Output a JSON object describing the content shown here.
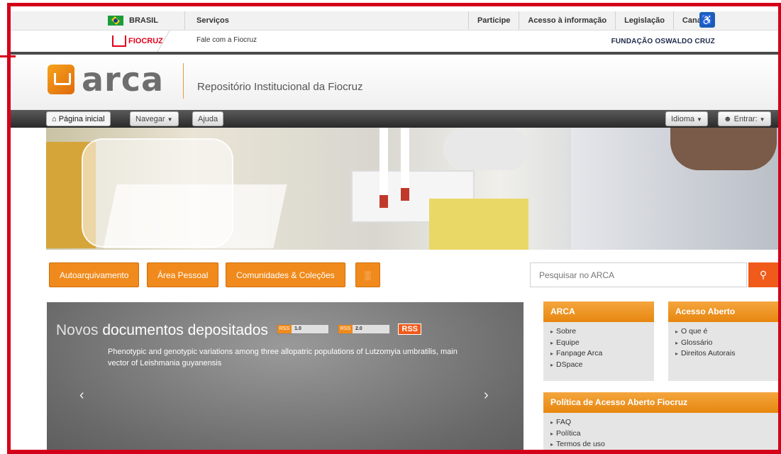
{
  "gov": {
    "country": "BRASIL",
    "services": "Serviços",
    "links": [
      "Participe",
      "Acesso à informação",
      "Legislação",
      "Canais"
    ]
  },
  "fiocruz": {
    "logo": "FIOCRUZ",
    "contact": "Fale com a Fiocruz",
    "foundation": "FUNDAÇÃO OSWALDO CRUZ"
  },
  "header": {
    "logo_text": "arca",
    "subtitle": "Repositório Institucional da Fiocruz"
  },
  "nav": {
    "home": "Página inicial",
    "browse": "Navegar",
    "help": "Ajuda",
    "language": "Idioma",
    "login": "Entrar:"
  },
  "actions": {
    "self_archive": "Autoarquivamento",
    "personal_area": "Área Pessoal",
    "communities": "Comunidades & Coleções"
  },
  "search": {
    "placeholder": "Pesquisar no ARCA"
  },
  "feed": {
    "title_light": "Novos",
    "title_rest": "documentos depositados",
    "rss1_a": "RSS",
    "rss1_b": "1.0",
    "rss2_a": "RSS",
    "rss2_b": "2.0",
    "rss_label": "RSS",
    "item": "Phenotypic and genotypic variations among three allopatric populations of Lutzomyia umbratilis, main vector of Leishmania guyanensis",
    "prev": "‹",
    "next": "›"
  },
  "panels": {
    "arca": {
      "title": "ARCA",
      "items": [
        "Sobre",
        "Equipe",
        "Fanpage Arca",
        "DSpace"
      ]
    },
    "open_access": {
      "title": "Acesso Aberto",
      "items": [
        "O que é",
        "Glossário",
        "Direitos Autorais"
      ]
    },
    "policy": {
      "title": "Política de Acesso Aberto Fiocruz",
      "items": [
        "FAQ",
        "Política",
        "Termos de uso"
      ]
    }
  },
  "colors": {
    "accent": "#f08a1c",
    "frame": "#d4001a",
    "search_button": "#f05a1a"
  }
}
